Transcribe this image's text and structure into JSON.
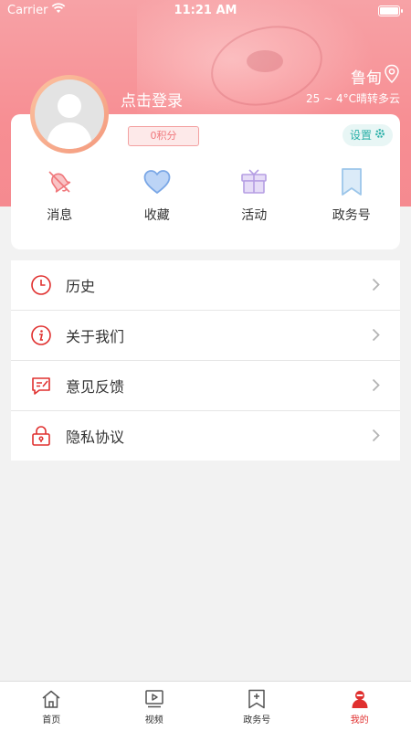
{
  "status_bar": {
    "carrier": "Carrier",
    "time": "11:21 AM"
  },
  "header": {
    "location": "鲁甸",
    "weather": "25 ~ 4°C晴转多云",
    "login_prompt": "点击登录"
  },
  "profile_card": {
    "points": "0积分",
    "settings_label": "设置",
    "shortcuts": [
      {
        "label": "消息",
        "icon": "bell-muted-icon",
        "color": "#f0767a"
      },
      {
        "label": "收藏",
        "icon": "heart-icon",
        "color": "#7aa7e6"
      },
      {
        "label": "活动",
        "icon": "gift-icon",
        "color": "#b59ee3"
      },
      {
        "label": "政务号",
        "icon": "bookmark-icon",
        "color": "#9cc6ea"
      }
    ]
  },
  "menu": [
    {
      "label": "历史",
      "icon": "clock-icon"
    },
    {
      "label": "关于我们",
      "icon": "info-icon"
    },
    {
      "label": "意见反馈",
      "icon": "feedback-icon"
    },
    {
      "label": "隐私协议",
      "icon": "lock-icon"
    }
  ],
  "tab_bar": [
    {
      "label": "首页",
      "icon": "home-icon",
      "active": false
    },
    {
      "label": "视频",
      "icon": "video-icon",
      "active": false
    },
    {
      "label": "政务号",
      "icon": "bookmark-plus-icon",
      "active": false
    },
    {
      "label": "我的",
      "icon": "user-icon",
      "active": true
    }
  ],
  "colors": {
    "accent": "#e0302f",
    "header": "#f78e93",
    "settings": "#2ab0a8"
  }
}
